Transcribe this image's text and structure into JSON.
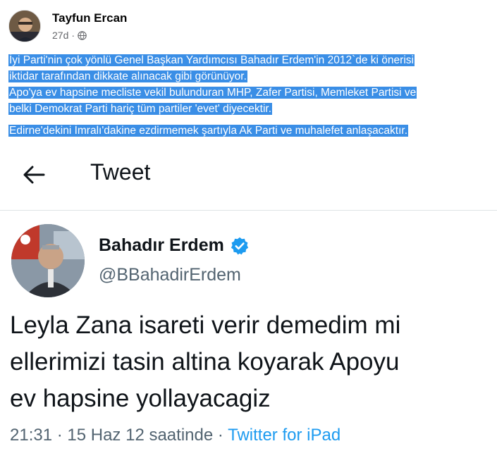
{
  "post": {
    "author": "Tayfun Ercan",
    "time": "27d",
    "dot": "·",
    "privacy_icon": "globe-icon",
    "paragraphs": [
      {
        "lines": [
          "İyi Parti'nin çok yönlü Genel Başkan Yardımcısı Bahadır Erdem'in 2012`de ki önerisi",
          "iktidar tarafından dikkate alınacak gibi görünüyor.",
          "Apo'ya ev hapsine mecliste vekil bulunduran MHP, Zafer Partisi, Memleket Partisi ve",
          "belki Demokrat Parti hariç tüm partiler 'evet' diyecektir."
        ]
      },
      {
        "lines": [
          "Edirne'dekini İmralı'dakine ezdirmemek şartıyla Ak Parti ve muhalefet anlaşacaktır."
        ]
      }
    ],
    "selection_color": "#3a8ee6"
  },
  "tweet": {
    "nav_title": "Tweet",
    "back_icon": "back-arrow-icon",
    "name": "Bahadır Erdem",
    "verified_icon": "verified-badge-icon",
    "handle": "@BBahadirErdem",
    "lines": [
      "Leyla Zana isareti verir demedim mi",
      "ellerimizi tasin altina koyarak Apoyu",
      "ev hapsine yollayacagiz"
    ],
    "timestamp": "21:31 · 15 Haz 12 saatinde",
    "separator": " · ",
    "source": "Twitter for iPad",
    "accent_color": "#1d9bf0"
  }
}
